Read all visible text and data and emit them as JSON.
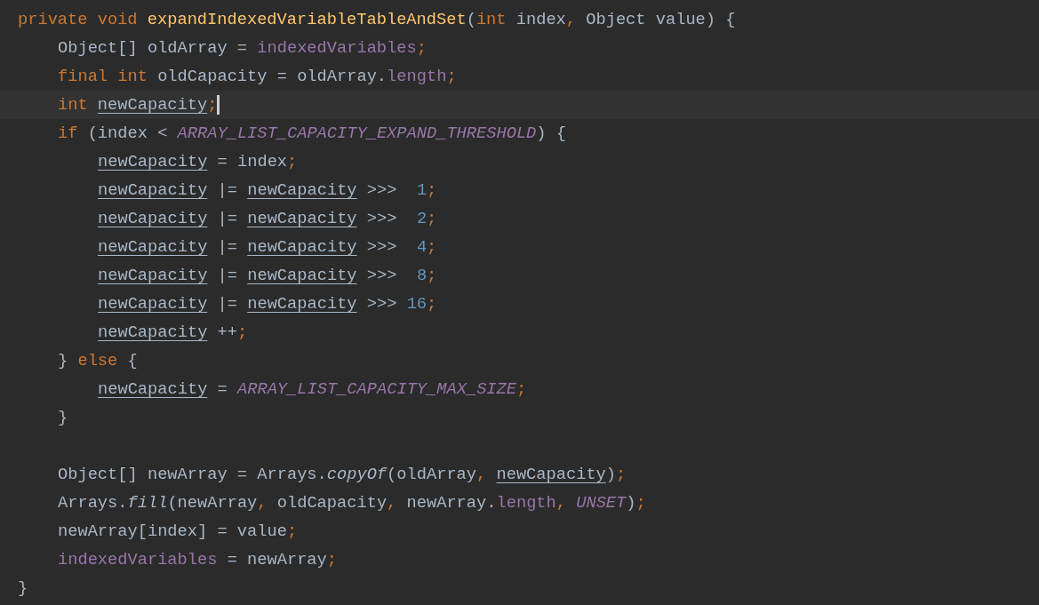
{
  "editor": {
    "lines": [
      {
        "current": false,
        "tokens": [
          {
            "kind": "kw",
            "text": "private void "
          },
          {
            "kind": "decl",
            "text": "expandIndexedVariableTableAndSet"
          },
          {
            "kind": "plain",
            "text": "("
          },
          {
            "kind": "kw",
            "text": "int"
          },
          {
            "kind": "plain",
            "text": " index"
          },
          {
            "kind": "punct",
            "text": ", "
          },
          {
            "kind": "plain",
            "text": "Object value) {"
          }
        ],
        "children": [
          {
            "current": false,
            "tokens": [
              {
                "kind": "plain",
                "text": "Object[] oldArray = "
              },
              {
                "kind": "field",
                "text": "indexedVariables"
              },
              {
                "kind": "punct",
                "text": ";"
              }
            ]
          },
          {
            "current": false,
            "tokens": [
              {
                "kind": "kw",
                "text": "final int "
              },
              {
                "kind": "plain",
                "text": "oldCapacity = oldArray."
              },
              {
                "kind": "field",
                "text": "length"
              },
              {
                "kind": "punct",
                "text": ";"
              }
            ]
          },
          {
            "current": true,
            "tokens": [
              {
                "kind": "kw",
                "text": "int "
              },
              {
                "kind": "var",
                "text": "newCapacity"
              },
              {
                "kind": "punct",
                "text": ";"
              }
            ]
          },
          {
            "current": false,
            "tokens": [
              {
                "kind": "kw",
                "text": "if "
              },
              {
                "kind": "plain",
                "text": "(index < "
              },
              {
                "kind": "const",
                "text": "ARRAY_LIST_CAPACITY_EXPAND_THRESHOLD"
              },
              {
                "kind": "plain",
                "text": ") {"
              }
            ],
            "children": [
              {
                "current": false,
                "tokens": [
                  {
                    "kind": "var",
                    "text": "newCapacity"
                  },
                  {
                    "kind": "plain",
                    "text": " = index"
                  },
                  {
                    "kind": "punct",
                    "text": ";"
                  }
                ]
              },
              {
                "current": false,
                "tokens": [
                  {
                    "kind": "var",
                    "text": "newCapacity"
                  },
                  {
                    "kind": "plain",
                    "text": " |= "
                  },
                  {
                    "kind": "var",
                    "text": "newCapacity"
                  },
                  {
                    "kind": "plain",
                    "text": " >>>  "
                  },
                  {
                    "kind": "num",
                    "text": "1"
                  },
                  {
                    "kind": "punct",
                    "text": ";"
                  }
                ]
              },
              {
                "current": false,
                "tokens": [
                  {
                    "kind": "var",
                    "text": "newCapacity"
                  },
                  {
                    "kind": "plain",
                    "text": " |= "
                  },
                  {
                    "kind": "var",
                    "text": "newCapacity"
                  },
                  {
                    "kind": "plain",
                    "text": " >>>  "
                  },
                  {
                    "kind": "num",
                    "text": "2"
                  },
                  {
                    "kind": "punct",
                    "text": ";"
                  }
                ]
              },
              {
                "current": false,
                "tokens": [
                  {
                    "kind": "var",
                    "text": "newCapacity"
                  },
                  {
                    "kind": "plain",
                    "text": " |= "
                  },
                  {
                    "kind": "var",
                    "text": "newCapacity"
                  },
                  {
                    "kind": "plain",
                    "text": " >>>  "
                  },
                  {
                    "kind": "num",
                    "text": "4"
                  },
                  {
                    "kind": "punct",
                    "text": ";"
                  }
                ]
              },
              {
                "current": false,
                "tokens": [
                  {
                    "kind": "var",
                    "text": "newCapacity"
                  },
                  {
                    "kind": "plain",
                    "text": " |= "
                  },
                  {
                    "kind": "var",
                    "text": "newCapacity"
                  },
                  {
                    "kind": "plain",
                    "text": " >>>  "
                  },
                  {
                    "kind": "num",
                    "text": "8"
                  },
                  {
                    "kind": "punct",
                    "text": ";"
                  }
                ]
              },
              {
                "current": false,
                "tokens": [
                  {
                    "kind": "var",
                    "text": "newCapacity"
                  },
                  {
                    "kind": "plain",
                    "text": " |= "
                  },
                  {
                    "kind": "var",
                    "text": "newCapacity"
                  },
                  {
                    "kind": "plain",
                    "text": " >>> "
                  },
                  {
                    "kind": "num",
                    "text": "16"
                  },
                  {
                    "kind": "punct",
                    "text": ";"
                  }
                ]
              },
              {
                "current": false,
                "tokens": [
                  {
                    "kind": "var",
                    "text": "newCapacity"
                  },
                  {
                    "kind": "plain",
                    "text": " ++"
                  },
                  {
                    "kind": "punct",
                    "text": ";"
                  }
                ]
              }
            ]
          },
          {
            "current": false,
            "tokens": [
              {
                "kind": "plain",
                "text": "} "
              },
              {
                "kind": "kw",
                "text": "else"
              },
              {
                "kind": "plain",
                "text": " {"
              }
            ],
            "children": [
              {
                "current": false,
                "tokens": [
                  {
                    "kind": "var",
                    "text": "newCapacity"
                  },
                  {
                    "kind": "plain",
                    "text": " = "
                  },
                  {
                    "kind": "const",
                    "text": "ARRAY_LIST_CAPACITY_MAX_SIZE"
                  },
                  {
                    "kind": "punct",
                    "text": ";"
                  }
                ]
              }
            ]
          },
          {
            "current": false,
            "tokens": [
              {
                "kind": "plain",
                "text": "}"
              }
            ]
          },
          {
            "current": false
          },
          {
            "current": false,
            "tokens": [
              {
                "kind": "plain",
                "text": "Object[] newArray = Arrays."
              },
              {
                "kind": "static",
                "text": "copyOf"
              },
              {
                "kind": "plain",
                "text": "(oldArray"
              },
              {
                "kind": "punct",
                "text": ", "
              },
              {
                "kind": "var",
                "text": "newCapacity"
              },
              {
                "kind": "plain",
                "text": ")"
              },
              {
                "kind": "punct",
                "text": ";"
              }
            ]
          },
          {
            "current": false,
            "tokens": [
              {
                "kind": "plain",
                "text": "Arrays."
              },
              {
                "kind": "static",
                "text": "fill"
              },
              {
                "kind": "plain",
                "text": "(newArray"
              },
              {
                "kind": "punct",
                "text": ", "
              },
              {
                "kind": "plain",
                "text": "oldCapacity"
              },
              {
                "kind": "punct",
                "text": ", "
              },
              {
                "kind": "plain",
                "text": "newArray."
              },
              {
                "kind": "field",
                "text": "length"
              },
              {
                "kind": "punct",
                "text": ", "
              },
              {
                "kind": "const",
                "text": "UNSET"
              },
              {
                "kind": "plain",
                "text": ")"
              },
              {
                "kind": "punct",
                "text": ";"
              }
            ]
          },
          {
            "current": false,
            "tokens": [
              {
                "kind": "plain",
                "text": "newArray[index] = value"
              },
              {
                "kind": "punct",
                "text": ";"
              }
            ]
          },
          {
            "current": false,
            "tokens": [
              {
                "kind": "field",
                "text": "indexedVariables"
              },
              {
                "kind": "plain",
                "text": " = newArray"
              },
              {
                "kind": "punct",
                "text": ";"
              }
            ]
          }
        ]
      },
      {
        "current": false,
        "tokens": [
          {
            "kind": "plain",
            "text": "}"
          }
        ]
      }
    ]
  }
}
